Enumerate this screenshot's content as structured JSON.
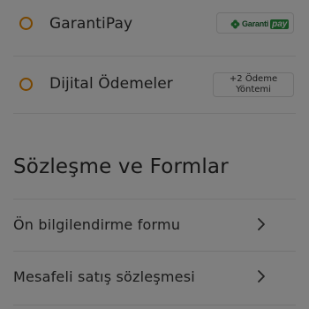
{
  "payment_options": [
    {
      "label": "GarantiPay",
      "selected": false,
      "badge": {
        "logo_text": "Garanti",
        "logo_accent": "pay"
      }
    },
    {
      "label": "Dijital Ödemeler",
      "selected": false,
      "badge": {
        "line1": "+2 Ödeme",
        "line2": "Yöntemi"
      }
    }
  ],
  "forms_section": {
    "title": "Sözleşme ve Formlar",
    "items": [
      {
        "label": "Ön bilgilendirme formu",
        "icon": "chevron-right-icon"
      },
      {
        "label": "Mesafeli satış sözleşmesi",
        "icon": "chevron-right-icon"
      }
    ]
  },
  "colors": {
    "radio_border": "#ef8c00",
    "garanti_green": "#2c9a45",
    "overlay": "rgba(0,0,0,0.5)"
  },
  "overlay_visible": true
}
